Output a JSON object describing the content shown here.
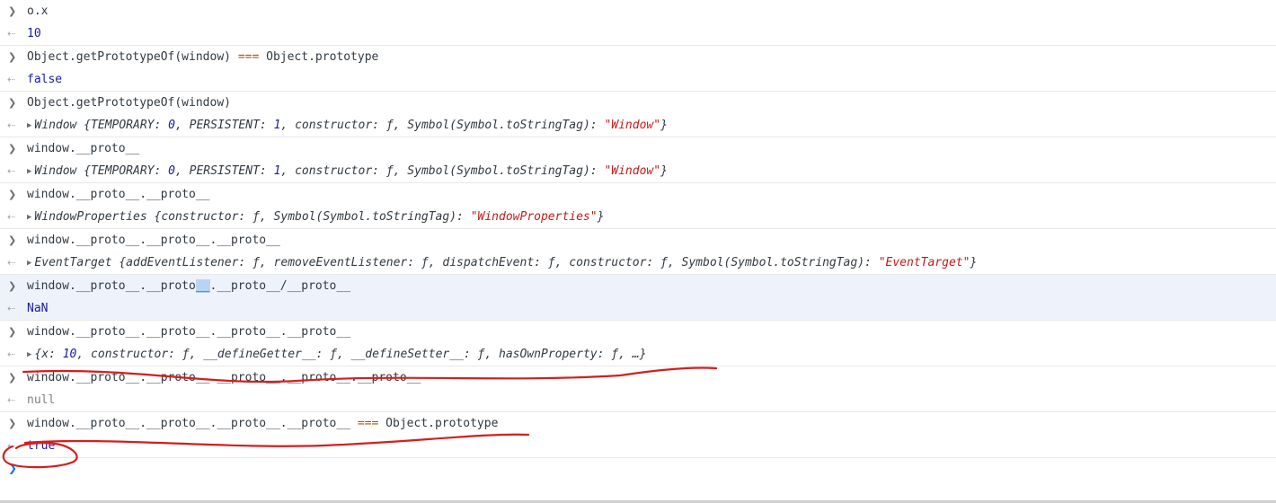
{
  "entries": [
    {
      "input": "o.x",
      "output": "10"
    },
    {
      "input_left": "Object.getPrototypeOf(window) ",
      "input_op": "===",
      "input_right": " Object.prototype",
      "output": "false"
    },
    {
      "input": "Object.getPrototypeOf(window)",
      "output_name": "Window",
      "output_body": {
        "k1": "TEMPORARY",
        "v1": "0",
        "k2": "PERSISTENT",
        "v2": "1",
        "k3": "constructor",
        "v3": "ƒ",
        "k4": "Symbol(Symbol.toStringTag)",
        "v4": "\"Window\""
      }
    },
    {
      "input": "window.__proto__",
      "output_name": "Window",
      "output_body": {
        "k1": "TEMPORARY",
        "v1": "0",
        "k2": "PERSISTENT",
        "v2": "1",
        "k3": "constructor",
        "v3": "ƒ",
        "k4": "Symbol(Symbol.toStringTag)",
        "v4": "\"Window\""
      }
    },
    {
      "input": "window.__proto__.__proto__",
      "output_name": "WindowProperties",
      "output_body": {
        "k1": "constructor",
        "v1": "ƒ",
        "k2": "Symbol(Symbol.toStringTag)",
        "v2": "\"WindowProperties\""
      }
    },
    {
      "input": "window.__proto__.__proto__.__proto__",
      "output_name": "EventTarget",
      "output_body": {
        "k1": "addEventListener",
        "v1": "ƒ",
        "k2": "removeEventListener",
        "v2": "ƒ",
        "k3": "dispatchEvent",
        "v3": "ƒ",
        "k4": "constructor",
        "v4": "ƒ",
        "k5": "Symbol(Symbol.toStringTag)",
        "v5": "\"EventTarget\""
      }
    },
    {
      "input_a": "window.__proto__.__proto",
      "input_sel": "__",
      "input_b": ".__proto__/__proto__",
      "output": "NaN"
    },
    {
      "input": "window.__proto__.__proto__.__proto__.__proto__",
      "output_body": {
        "k1": "x",
        "v1": "10",
        "k2": "constructor",
        "v2": "ƒ",
        "k3": "__defineGetter__",
        "v3": "ƒ",
        "k4": "__defineSetter__",
        "v4": "ƒ",
        "k5": "hasOwnProperty",
        "v5": "ƒ",
        "more": "…"
      }
    },
    {
      "input": "window.__proto__.__proto__.__proto__.__proto__.__proto__",
      "output": "null"
    },
    {
      "input_left": "window.__proto__.__proto__.__proto__.__proto__ ",
      "input_op": "===",
      "input_right": " Object.prototype",
      "output": "true"
    }
  ],
  "colors": {
    "annotation": "#d41e1e",
    "prompt": "#1a73e8"
  },
  "icons": {
    "input": "chevron-right-icon",
    "output": "return-arrow-icon",
    "expand": "expand-triangle-icon"
  }
}
